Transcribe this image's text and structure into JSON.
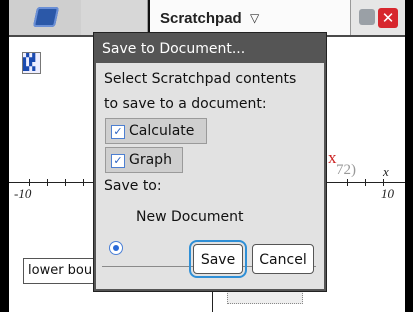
{
  "titlebar": {
    "title": "Scratchpad",
    "dropdown_icon": "chevron-down-icon",
    "calculator_icon": "calculator-icon",
    "graph_icon": "graph-icon",
    "settings_icon": "settings-icon",
    "close_icon": "close-icon",
    "close_glyph": "✕",
    "close_color": "#d7262d"
  },
  "graph": {
    "x_min_label": "-10",
    "x_max_label": "10",
    "x_axis_label": "x",
    "function_hint_var": "x",
    "function_hint_tail": "72)",
    "lower_bound_value": "lower bou"
  },
  "dialog": {
    "title": "Save to Document...",
    "prompt_line1": "Select Scratchpad contents",
    "prompt_line2": "to save to a document:",
    "options": [
      {
        "label": "Calculate",
        "checked": true
      },
      {
        "label": "Graph",
        "checked": true
      }
    ],
    "save_to_label": "Save to:",
    "destination": {
      "label": "New Document",
      "selected": true
    },
    "buttons": {
      "save": "Save",
      "cancel": "Cancel"
    },
    "accent_color": "#2f8fd6"
  }
}
